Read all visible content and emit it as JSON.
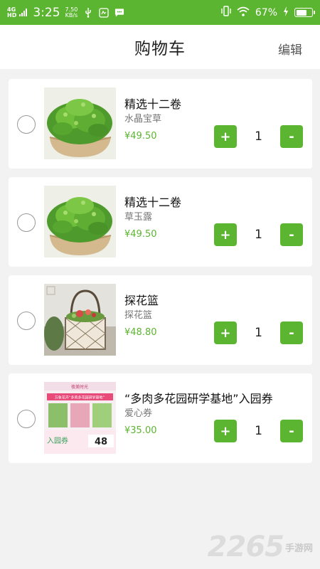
{
  "status_bar": {
    "network": "4G",
    "network_sub": "HD",
    "time": "3:25",
    "speed_value": "7.50",
    "speed_unit": "KB/s",
    "battery": "67%",
    "battery_level": 0.67
  },
  "header": {
    "title": "购物车",
    "edit_label": "编辑"
  },
  "cart": {
    "items": [
      {
        "name": "精选十二卷",
        "subtitle": "水晶宝草",
        "price": "¥49.50",
        "quantity": "1",
        "plus": "+",
        "minus": "-"
      },
      {
        "name": "精选十二卷",
        "subtitle": "草玉露",
        "price": "¥49.50",
        "quantity": "1",
        "plus": "+",
        "minus": "-"
      },
      {
        "name": "探花篮",
        "subtitle": "探花篮",
        "price": "¥48.80",
        "quantity": "1",
        "plus": "+",
        "minus": "-"
      },
      {
        "name": "“多肉多花园研学基地”入园券",
        "subtitle": "爱心券",
        "price": "¥35.00",
        "quantity": "1",
        "plus": "+",
        "minus": "-"
      }
    ]
  },
  "ticket_image": {
    "top_text": "夜美时光",
    "banner": "万象花卉“多肉多花园研学基地”",
    "label": "入园券",
    "price": "48"
  },
  "watermark": {
    "number": "2265",
    "text": "手游网"
  },
  "colors": {
    "accent": "#5cb531",
    "price": "#5cb531",
    "background": "#f2f2f2"
  }
}
